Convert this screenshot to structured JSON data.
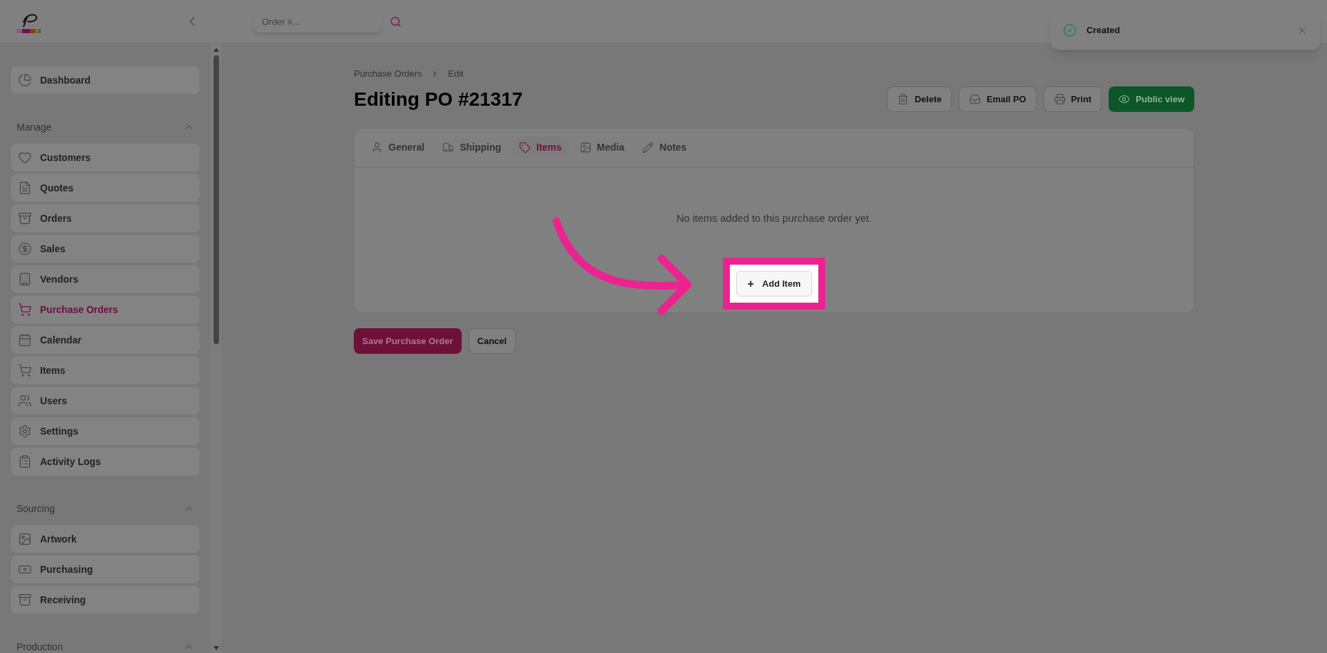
{
  "header": {
    "search": {
      "placeholder": "Order #..."
    }
  },
  "sidebar": {
    "top_items": [
      {
        "label": "Dashboard",
        "selected": false
      }
    ],
    "sections": [
      {
        "title": "Manage",
        "expanded": true,
        "items": [
          {
            "label": "Customers",
            "selected": false
          },
          {
            "label": "Quotes",
            "selected": false
          },
          {
            "label": "Orders",
            "selected": false
          },
          {
            "label": "Sales",
            "selected": false
          },
          {
            "label": "Vendors",
            "selected": false
          },
          {
            "label": "Purchase Orders",
            "selected": true
          },
          {
            "label": "Calendar",
            "selected": false
          },
          {
            "label": "Items",
            "selected": false
          },
          {
            "label": "Users",
            "selected": false
          },
          {
            "label": "Settings",
            "selected": false
          },
          {
            "label": "Activity Logs",
            "selected": false
          }
        ]
      },
      {
        "title": "Sourcing",
        "expanded": true,
        "items": [
          {
            "label": "Artwork",
            "selected": false
          },
          {
            "label": "Purchasing",
            "selected": false
          },
          {
            "label": "Receiving",
            "selected": false
          }
        ]
      },
      {
        "title": "Production",
        "expanded": true
      }
    ]
  },
  "breadcrumb": [
    "Purchase Orders",
    "Edit"
  ],
  "title": "Editing PO #21317",
  "actions": [
    {
      "label": "Delete",
      "kind": "delete"
    },
    {
      "label": "Email PO",
      "kind": "email"
    },
    {
      "label": "Print",
      "kind": "print"
    },
    {
      "label": "Public view",
      "kind": "public"
    }
  ],
  "tabs": [
    {
      "label": "General",
      "selected": false
    },
    {
      "label": "Shipping",
      "selected": false
    },
    {
      "label": "Items",
      "selected": true
    },
    {
      "label": "Media",
      "selected": false
    },
    {
      "label": "Notes",
      "selected": false
    }
  ],
  "empty_message": "No items added to this purchase order yet.",
  "add_button": {
    "icon": "+",
    "label": "Add Item"
  },
  "form_buttons": [
    {
      "label": "Save Purchase Order",
      "kind": "primary"
    },
    {
      "label": "Cancel",
      "kind": "secondary"
    }
  ],
  "toast": {
    "message": "Created"
  }
}
